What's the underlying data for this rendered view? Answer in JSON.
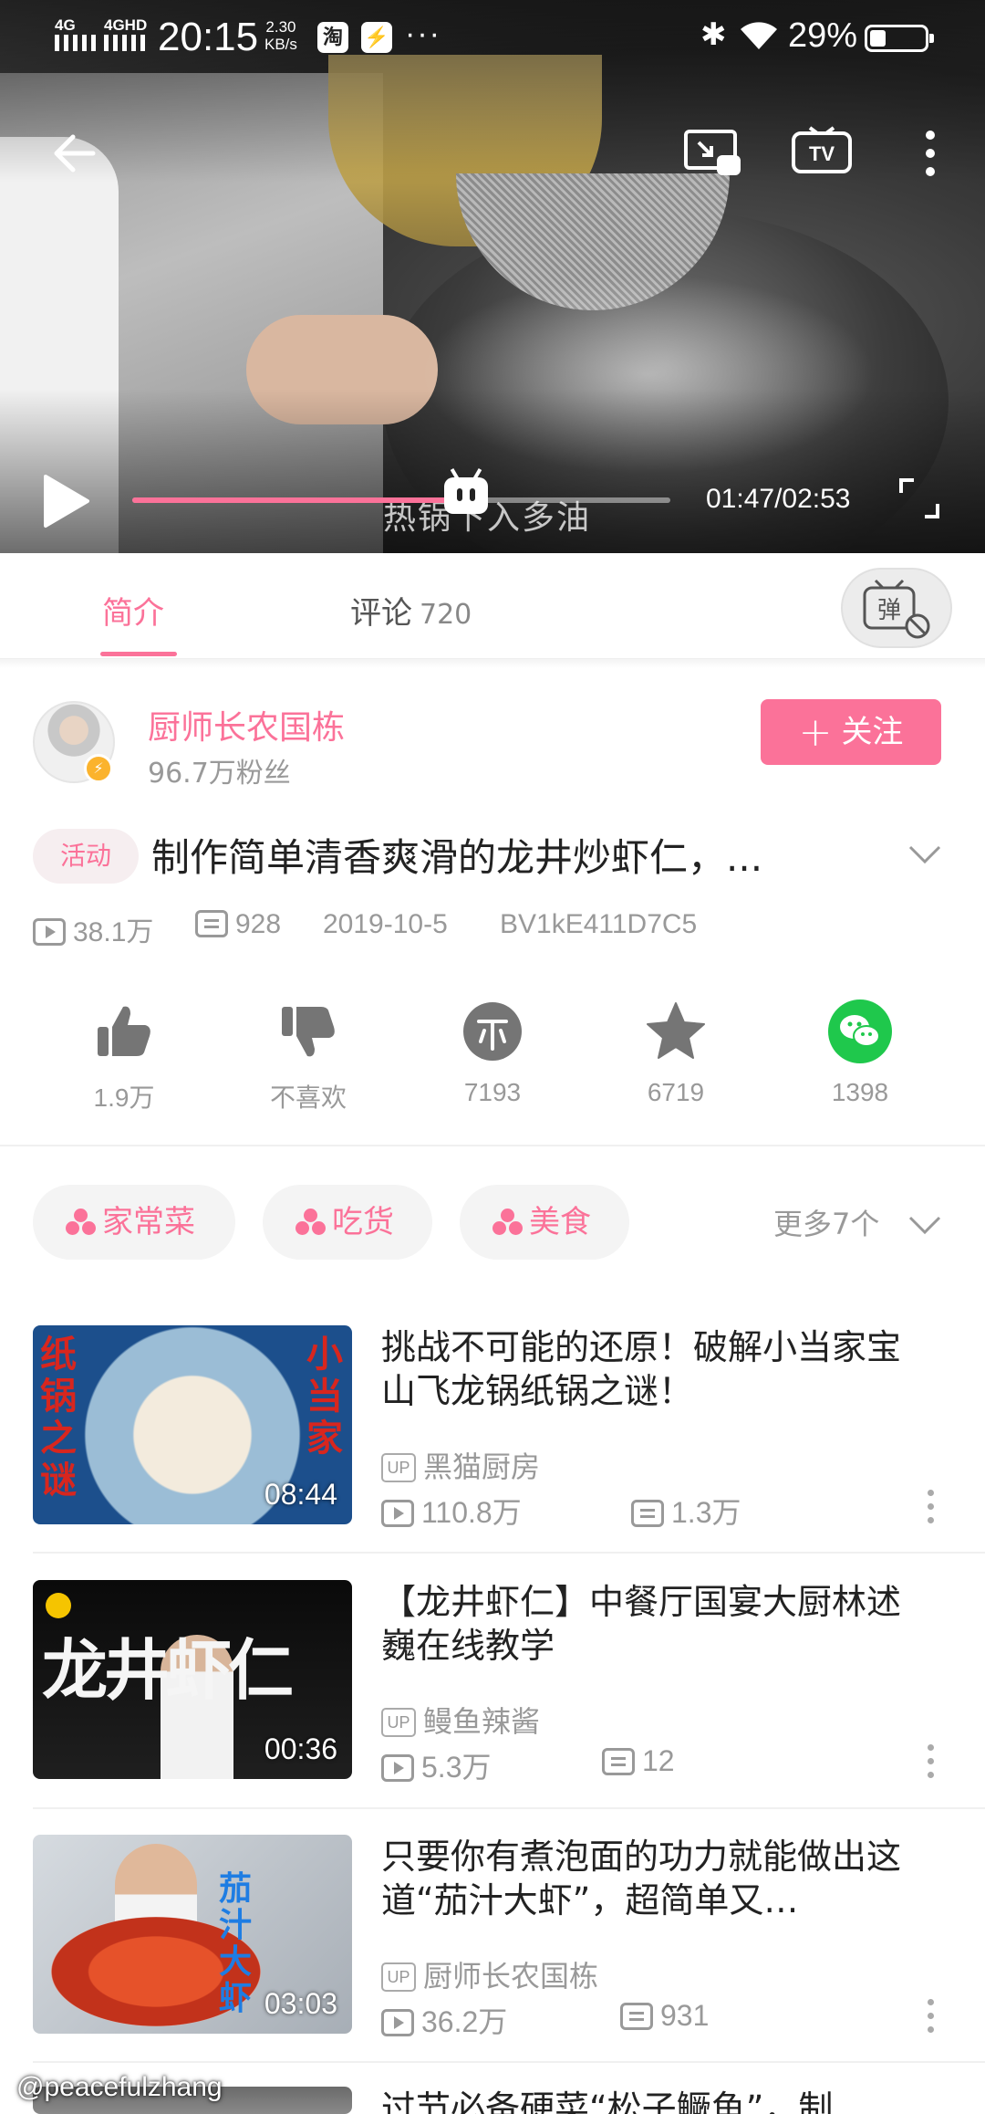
{
  "status_bar": {
    "network_1": "4G",
    "network_2": "4GHD",
    "time": "20:15",
    "speed_value": "2.30",
    "speed_unit": "KB/s",
    "app_icon_1": "淘",
    "more": "···",
    "battery": "29%"
  },
  "player": {
    "subtitle": "热锅下入多油",
    "time_display": "01:47/02:53",
    "progress": 0.62
  },
  "tabs": {
    "intro": "简介",
    "comments": "评论",
    "comment_count": "720",
    "danmaku_label": "弹"
  },
  "uploader": {
    "name": "厨师长农国栋",
    "fans": "96.7万粉丝",
    "follow_label": "关注"
  },
  "video": {
    "activity_badge": "活动",
    "title": "制作简单清香爽滑的龙井炒虾仁，...",
    "views": "38.1万",
    "danmaku": "928",
    "date": "2019-10-5",
    "bvid": "BV1kE411D7C5"
  },
  "actions": [
    {
      "icon": "thumbs-up-icon",
      "label": "1.9万"
    },
    {
      "icon": "thumbs-down-icon",
      "label": "不喜欢"
    },
    {
      "icon": "coin-icon",
      "label": "7193"
    },
    {
      "icon": "star-icon",
      "label": "6719"
    },
    {
      "icon": "wechat-icon",
      "label": "1398"
    }
  ],
  "tags": [
    "家常菜",
    "吃货",
    "美食"
  ],
  "more_tags": "更多7个",
  "recommendations": [
    {
      "title": "挑战不可能的还原！破解小当家宝山飞龙锅纸锅之谜！",
      "uploader": "黑猫厨房",
      "views": "110.8万",
      "danmaku": "1.3万",
      "duration": "08:44",
      "thumb_text_left": [
        "纸",
        "锅",
        "之",
        "谜"
      ],
      "thumb_text_right": [
        "小",
        "当",
        "家"
      ]
    },
    {
      "title": "【龙井虾仁】中餐厅国宴大厨林述巍在线教学",
      "uploader": "鳗鱼辣酱",
      "views": "5.3万",
      "danmaku": "12",
      "duration": "00:36",
      "thumb_text": "龙井虾仁"
    },
    {
      "title": "只要你有煮泡面的功力就能做出这道“茄汁大虾”，超简单又…",
      "uploader": "厨师长农国栋",
      "views": "36.2万",
      "danmaku": "931",
      "duration": "03:03",
      "thumb_text": [
        "茄",
        "汁",
        "大",
        "虾"
      ]
    },
    {
      "title": "过节必备硬菜“松子鳜鱼”，制"
    }
  ],
  "up_tag": "UP",
  "watermark": "@peacefulzhang",
  "colors": {
    "accent": "#fb7299",
    "wechat": "#1fc84c",
    "text_secondary": "#999999"
  }
}
